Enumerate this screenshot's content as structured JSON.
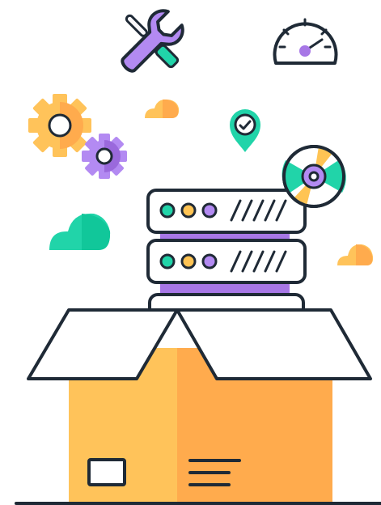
{
  "illustration": {
    "subject": "",
    "icons": [
      "wrench-screwdriver-icon",
      "speedometer-icon",
      "gear-icon",
      "cloud-icon",
      "location-check-icon",
      "disc-icon",
      "server-rack-icon",
      "shipping-box-icon"
    ]
  },
  "colors": {
    "outline": "#1f2a36",
    "box_light": "#ffc35a",
    "box_dark": "#ffab4d",
    "purple": "#a777e6",
    "purple_light": "#b38af2",
    "teal": "#21d4a9",
    "yellow": "#ffc454",
    "white": "#ffffff"
  }
}
